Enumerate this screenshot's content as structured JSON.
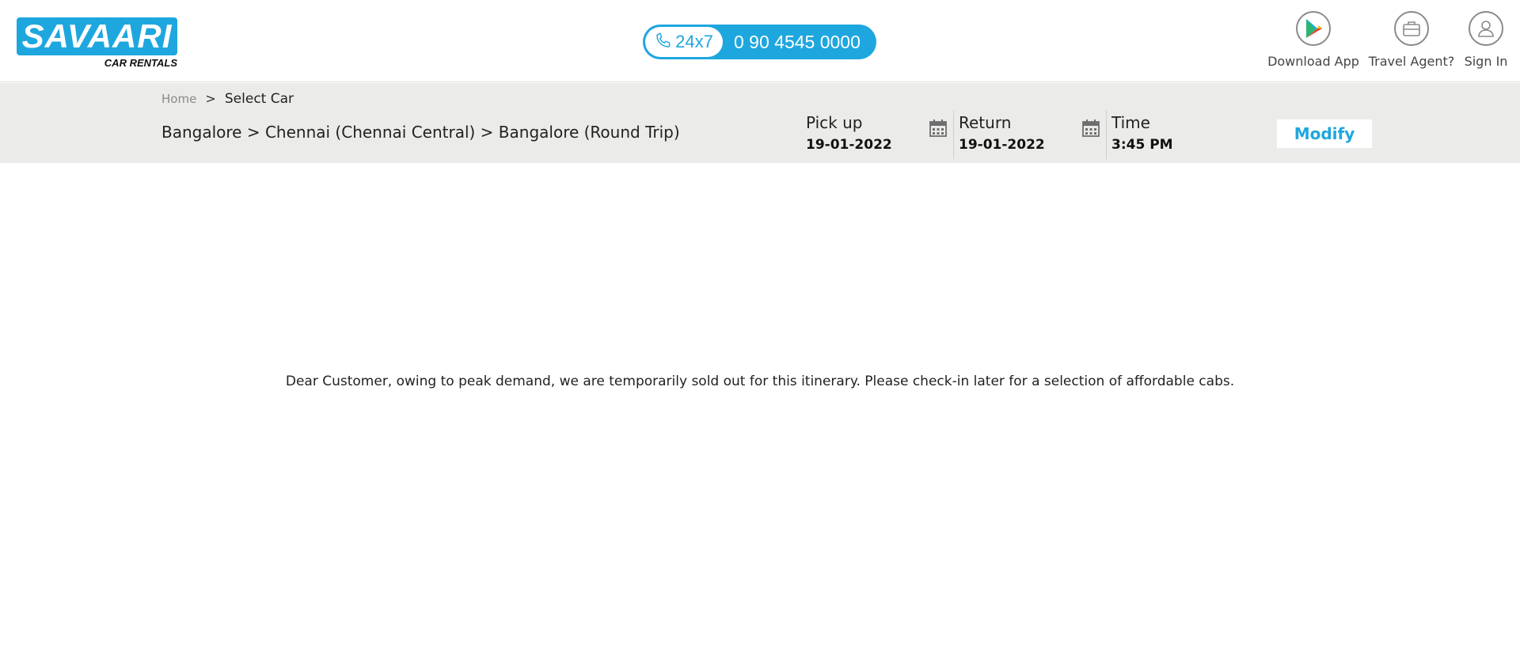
{
  "header": {
    "logo_text": "SAVAARI",
    "logo_sub": "CAR RENTALS",
    "support_label": "24x7",
    "support_phone": "0 90 4545 0000",
    "nav": {
      "download": "Download App",
      "agent": "Travel Agent?",
      "signin": "Sign In"
    }
  },
  "breadcrumb": {
    "home": "Home",
    "separator": ">",
    "current": "Select Car"
  },
  "trip": {
    "route": "Bangalore > Chennai (Chennai Central) > Bangalore (Round Trip)",
    "pickup_label": "Pick up",
    "pickup_date": "19-01-2022",
    "return_label": "Return",
    "return_date": "19-01-2022",
    "time_label": "Time",
    "time_value": "3:45 PM",
    "modify_label": "Modify"
  },
  "notice": "Dear Customer, owing to peak demand, we are temporarily sold out for this itinerary. Please check-in later for a selection of affordable cabs.",
  "colors": {
    "brand_blue": "#1ea7df",
    "subbar_bg": "#ebebe9"
  },
  "icons": [
    "phone-icon",
    "play-store-icon",
    "briefcase-icon",
    "user-icon",
    "calendar-icon"
  ]
}
